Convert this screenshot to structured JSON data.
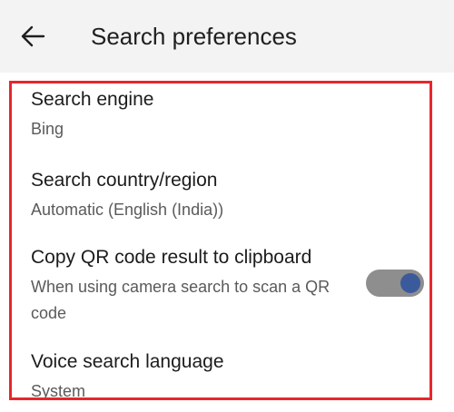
{
  "header": {
    "title": "Search preferences",
    "back_icon": "arrow-left-icon"
  },
  "preferences": [
    {
      "title": "Search engine",
      "subtitle": "Bing"
    },
    {
      "title": "Search country/region",
      "subtitle": "Automatic (English (India))"
    },
    {
      "title": "Copy QR code result to clipboard",
      "subtitle": "When using camera search to scan a QR code",
      "toggle_on": true
    },
    {
      "title": "Voice search language",
      "subtitle": "System"
    }
  ],
  "colors": {
    "highlight_border": "#e8262b",
    "toggle_track": "#8e8e8e",
    "toggle_knob": "#3a5a9c"
  }
}
